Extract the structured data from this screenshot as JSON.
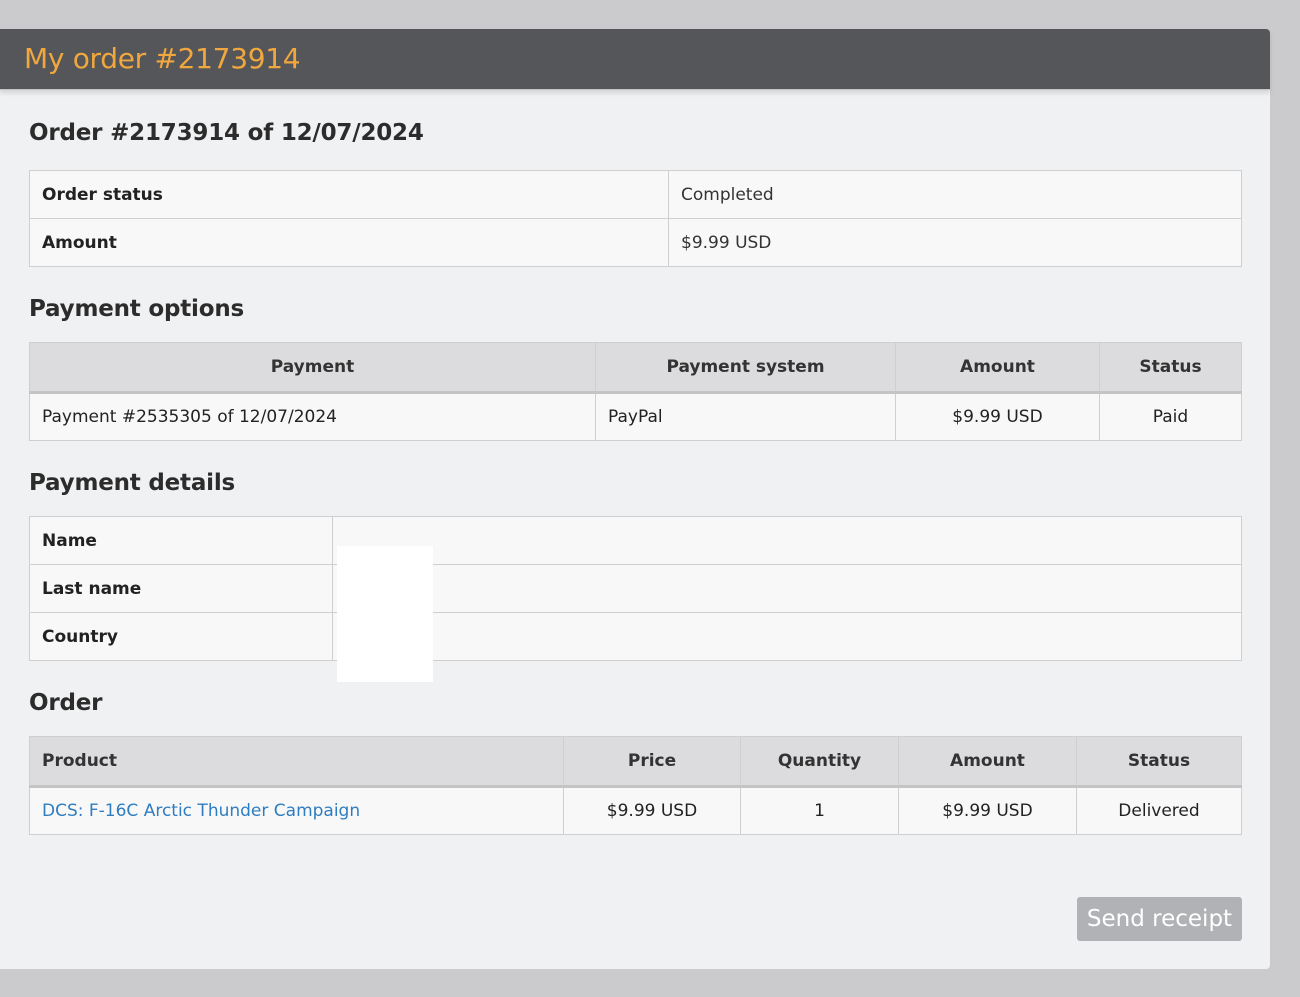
{
  "header": {
    "title": "My order #2173914"
  },
  "order_summary": {
    "heading": "Order #2173914 of 12/07/2024",
    "rows": [
      {
        "label": "Order status",
        "value": "Completed"
      },
      {
        "label": "Amount",
        "value": "$9.99 USD"
      }
    ]
  },
  "payment_options": {
    "heading": "Payment options",
    "columns": [
      "Payment",
      "Payment system",
      "Amount",
      "Status"
    ],
    "rows": [
      {
        "payment": "Payment #2535305 of 12/07/2024",
        "system": "PayPal",
        "amount": "$9.99 USD",
        "status": "Paid"
      }
    ]
  },
  "payment_details": {
    "heading": "Payment details",
    "rows": [
      {
        "label": "Name",
        "value": ""
      },
      {
        "label": "Last name",
        "value": ""
      },
      {
        "label": "Country",
        "value": ""
      }
    ]
  },
  "order": {
    "heading": "Order",
    "columns": [
      "Product",
      "Price",
      "Quantity",
      "Amount",
      "Status"
    ],
    "rows": [
      {
        "product": "DCS: F-16C Arctic Thunder Campaign",
        "price": "$9.99 USD",
        "quantity": "1",
        "amount": "$9.99 USD",
        "status": "Delivered"
      }
    ]
  },
  "actions": {
    "send_receipt_label": "Send receipt"
  },
  "colors": {
    "header_bg": "#55565a",
    "title": "#f0a73e",
    "link": "#2f7dc1",
    "button_bg": "#b1b2b5"
  }
}
